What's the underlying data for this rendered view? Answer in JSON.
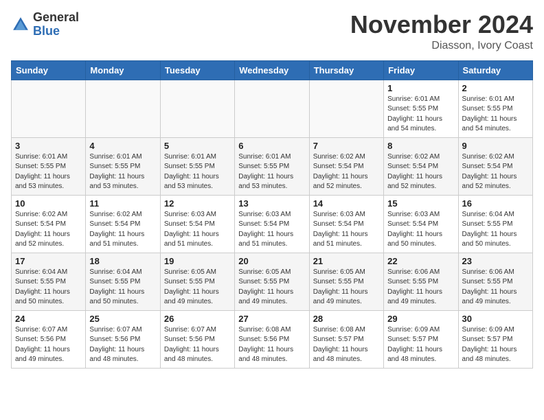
{
  "header": {
    "logo_general": "General",
    "logo_blue": "Blue",
    "month": "November 2024",
    "location": "Diasson, Ivory Coast"
  },
  "weekdays": [
    "Sunday",
    "Monday",
    "Tuesday",
    "Wednesday",
    "Thursday",
    "Friday",
    "Saturday"
  ],
  "weeks": [
    {
      "row_class": "row-white",
      "days": [
        {
          "date": "",
          "info": "",
          "empty": true
        },
        {
          "date": "",
          "info": "",
          "empty": true
        },
        {
          "date": "",
          "info": "",
          "empty": true
        },
        {
          "date": "",
          "info": "",
          "empty": true
        },
        {
          "date": "",
          "info": "",
          "empty": true
        },
        {
          "date": "1",
          "info": "Sunrise: 6:01 AM\nSunset: 5:55 PM\nDaylight: 11 hours\nand 54 minutes."
        },
        {
          "date": "2",
          "info": "Sunrise: 6:01 AM\nSunset: 5:55 PM\nDaylight: 11 hours\nand 54 minutes."
        }
      ]
    },
    {
      "row_class": "row-gray",
      "days": [
        {
          "date": "3",
          "info": "Sunrise: 6:01 AM\nSunset: 5:55 PM\nDaylight: 11 hours\nand 53 minutes."
        },
        {
          "date": "4",
          "info": "Sunrise: 6:01 AM\nSunset: 5:55 PM\nDaylight: 11 hours\nand 53 minutes."
        },
        {
          "date": "5",
          "info": "Sunrise: 6:01 AM\nSunset: 5:55 PM\nDaylight: 11 hours\nand 53 minutes."
        },
        {
          "date": "6",
          "info": "Sunrise: 6:01 AM\nSunset: 5:55 PM\nDaylight: 11 hours\nand 53 minutes."
        },
        {
          "date": "7",
          "info": "Sunrise: 6:02 AM\nSunset: 5:54 PM\nDaylight: 11 hours\nand 52 minutes."
        },
        {
          "date": "8",
          "info": "Sunrise: 6:02 AM\nSunset: 5:54 PM\nDaylight: 11 hours\nand 52 minutes."
        },
        {
          "date": "9",
          "info": "Sunrise: 6:02 AM\nSunset: 5:54 PM\nDaylight: 11 hours\nand 52 minutes."
        }
      ]
    },
    {
      "row_class": "row-white",
      "days": [
        {
          "date": "10",
          "info": "Sunrise: 6:02 AM\nSunset: 5:54 PM\nDaylight: 11 hours\nand 52 minutes."
        },
        {
          "date": "11",
          "info": "Sunrise: 6:02 AM\nSunset: 5:54 PM\nDaylight: 11 hours\nand 51 minutes."
        },
        {
          "date": "12",
          "info": "Sunrise: 6:03 AM\nSunset: 5:54 PM\nDaylight: 11 hours\nand 51 minutes."
        },
        {
          "date": "13",
          "info": "Sunrise: 6:03 AM\nSunset: 5:54 PM\nDaylight: 11 hours\nand 51 minutes."
        },
        {
          "date": "14",
          "info": "Sunrise: 6:03 AM\nSunset: 5:54 PM\nDaylight: 11 hours\nand 51 minutes."
        },
        {
          "date": "15",
          "info": "Sunrise: 6:03 AM\nSunset: 5:54 PM\nDaylight: 11 hours\nand 50 minutes."
        },
        {
          "date": "16",
          "info": "Sunrise: 6:04 AM\nSunset: 5:55 PM\nDaylight: 11 hours\nand 50 minutes."
        }
      ]
    },
    {
      "row_class": "row-gray",
      "days": [
        {
          "date": "17",
          "info": "Sunrise: 6:04 AM\nSunset: 5:55 PM\nDaylight: 11 hours\nand 50 minutes."
        },
        {
          "date": "18",
          "info": "Sunrise: 6:04 AM\nSunset: 5:55 PM\nDaylight: 11 hours\nand 50 minutes."
        },
        {
          "date": "19",
          "info": "Sunrise: 6:05 AM\nSunset: 5:55 PM\nDaylight: 11 hours\nand 49 minutes."
        },
        {
          "date": "20",
          "info": "Sunrise: 6:05 AM\nSunset: 5:55 PM\nDaylight: 11 hours\nand 49 minutes."
        },
        {
          "date": "21",
          "info": "Sunrise: 6:05 AM\nSunset: 5:55 PM\nDaylight: 11 hours\nand 49 minutes."
        },
        {
          "date": "22",
          "info": "Sunrise: 6:06 AM\nSunset: 5:55 PM\nDaylight: 11 hours\nand 49 minutes."
        },
        {
          "date": "23",
          "info": "Sunrise: 6:06 AM\nSunset: 5:55 PM\nDaylight: 11 hours\nand 49 minutes."
        }
      ]
    },
    {
      "row_class": "row-white",
      "days": [
        {
          "date": "24",
          "info": "Sunrise: 6:07 AM\nSunset: 5:56 PM\nDaylight: 11 hours\nand 49 minutes."
        },
        {
          "date": "25",
          "info": "Sunrise: 6:07 AM\nSunset: 5:56 PM\nDaylight: 11 hours\nand 48 minutes."
        },
        {
          "date": "26",
          "info": "Sunrise: 6:07 AM\nSunset: 5:56 PM\nDaylight: 11 hours\nand 48 minutes."
        },
        {
          "date": "27",
          "info": "Sunrise: 6:08 AM\nSunset: 5:56 PM\nDaylight: 11 hours\nand 48 minutes."
        },
        {
          "date": "28",
          "info": "Sunrise: 6:08 AM\nSunset: 5:57 PM\nDaylight: 11 hours\nand 48 minutes."
        },
        {
          "date": "29",
          "info": "Sunrise: 6:09 AM\nSunset: 5:57 PM\nDaylight: 11 hours\nand 48 minutes."
        },
        {
          "date": "30",
          "info": "Sunrise: 6:09 AM\nSunset: 5:57 PM\nDaylight: 11 hours\nand 48 minutes."
        }
      ]
    }
  ]
}
